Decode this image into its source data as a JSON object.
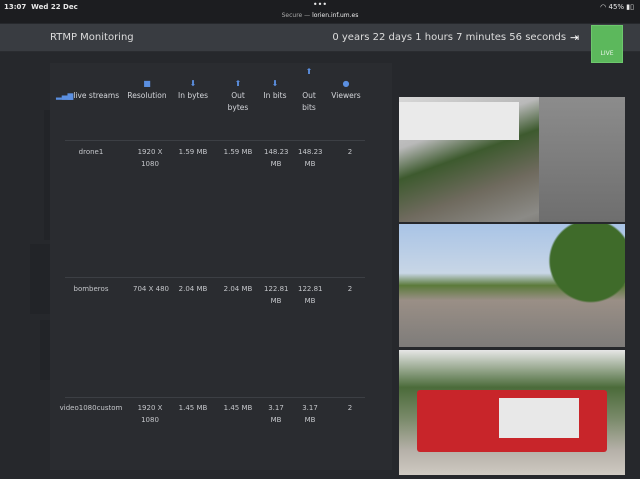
{
  "status_bar": {
    "time": "13:07",
    "date": "Wed 22 Dec",
    "dots": "•••",
    "secure": "Secure —",
    "host": "lorien.inf.um.es",
    "battery": "45%"
  },
  "header": {
    "title": "RTMP Monitoring",
    "uptime": "0 years 22 days 1 hours 7 minutes 56 seconds",
    "live_label": "LIVE"
  },
  "table": {
    "columns": [
      {
        "label": "live streams",
        "icon": "signal-icon"
      },
      {
        "label": "Resolution",
        "icon": "video-camera-icon"
      },
      {
        "label": "In bytes",
        "icon": "download-circle-icon"
      },
      {
        "label": "Out bytes",
        "icon": "upload-circle-icon"
      },
      {
        "label": "In bits",
        "icon": "download-circle-icon"
      },
      {
        "label": "Out bits",
        "icon": "upload-circle-icon"
      },
      {
        "label": "Viewers",
        "icon": "user-icon"
      }
    ],
    "rows": [
      {
        "name": "drone1",
        "resolution": "1920 X 1080",
        "in_bytes": "1.59 MB",
        "out_bytes": "1.59 MB",
        "in_bits": "148.23 MB",
        "out_bits": "148.23 MB",
        "viewers": "2"
      },
      {
        "name": "bomberos",
        "resolution": "704 X 480",
        "in_bytes": "2.04 MB",
        "out_bytes": "2.04 MB",
        "in_bits": "122.81 MB",
        "out_bits": "122.81 MB",
        "viewers": "2"
      },
      {
        "name": "video1080custom",
        "resolution": "1920 X 1080",
        "in_bytes": "1.45 MB",
        "out_bytes": "1.45 MB",
        "in_bits": "3.17 MB",
        "out_bits": "3.17 MB",
        "viewers": "2"
      }
    ]
  }
}
